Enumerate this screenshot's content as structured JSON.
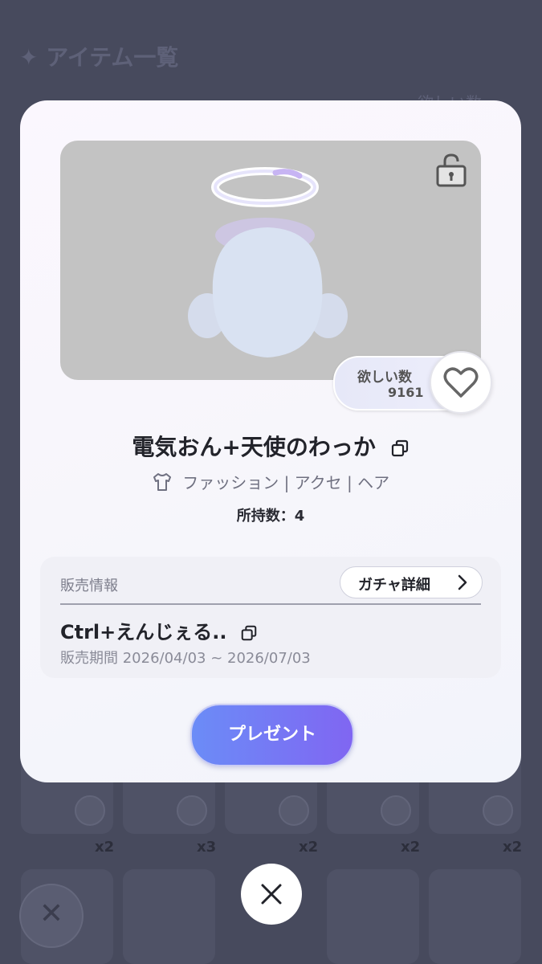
{
  "background": {
    "header_title": "✦ アイテム一覧",
    "wish_sort_label": "欲しい数",
    "counts": [
      "x2",
      "x3",
      "x2",
      "x2",
      "x2"
    ]
  },
  "modal": {
    "wish": {
      "label": "欲しい数",
      "value": "9161"
    },
    "item_name": "電気おん+天使のわっか",
    "category": "ファッション | アクセ | ヘア",
    "owned": "所持数：4",
    "sales": {
      "label": "販売情報",
      "gacha_button": "ガチャ詳細",
      "gacha_name": "Ctrl+えんじぇる..",
      "period": "販売期間 2026/04/03 ~ 2026/07/03"
    },
    "present_button": "プレゼント"
  },
  "colors": {
    "accent_start": "#6b8cf7",
    "accent_end": "#8066f2",
    "overlay": "#474a5d"
  }
}
